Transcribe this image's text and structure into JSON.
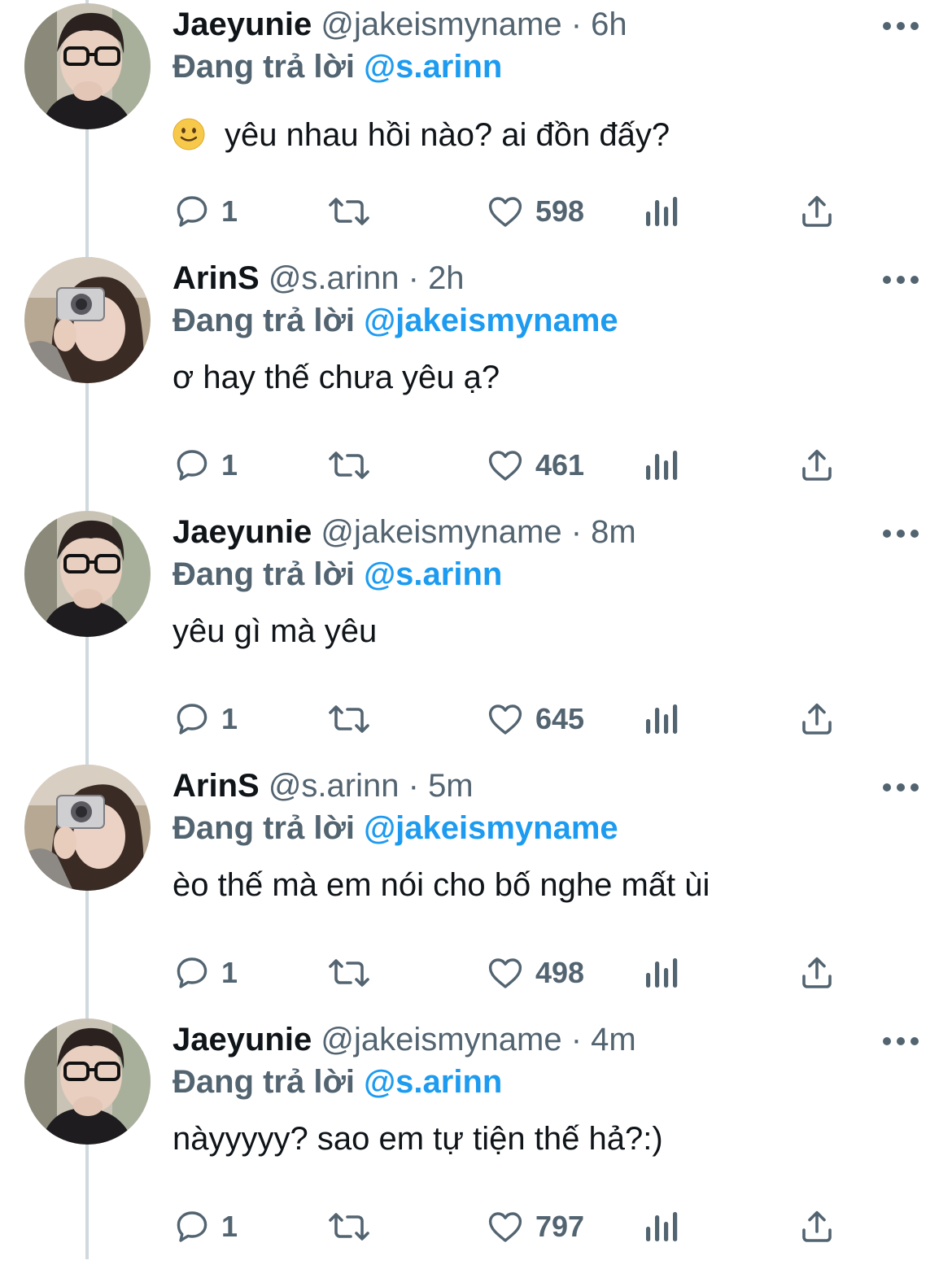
{
  "reply_prefix": "Đang trả lời",
  "tweets": [
    {
      "display_name": "Jaeyunie",
      "handle": "@jakeismyname",
      "separator": "·",
      "time": "6h",
      "replying_to": "@s.arinn",
      "emoji": "slightly-smiling-face",
      "text": "yêu nhau hồi nào? ai đồn đấy?",
      "replies": "1",
      "likes": "598",
      "avatar": "jaeyunie-avatar"
    },
    {
      "display_name": "ArinS",
      "handle": "@s.arinn",
      "separator": "·",
      "time": "2h",
      "replying_to": "@jakeismyname",
      "text": "ơ hay thế chưa yêu ạ?",
      "replies": "1",
      "likes": "461",
      "avatar": "arins-avatar"
    },
    {
      "display_name": "Jaeyunie",
      "handle": "@jakeismyname",
      "separator": "·",
      "time": "8m",
      "replying_to": "@s.arinn",
      "text": "yêu gì mà yêu",
      "replies": "1",
      "likes": "645",
      "avatar": "jaeyunie-avatar"
    },
    {
      "display_name": "ArinS",
      "handle": "@s.arinn",
      "separator": "·",
      "time": "5m",
      "replying_to": "@jakeismyname",
      "text": "èo thế mà em nói cho bố nghe mất ùi",
      "replies": "1",
      "likes": "498",
      "avatar": "arins-avatar"
    },
    {
      "display_name": "Jaeyunie",
      "handle": "@jakeismyname",
      "separator": "·",
      "time": "4m",
      "replying_to": "@s.arinn",
      "text": "nàyyyyy? sao em tự tiện thế hả?:)",
      "replies": "1",
      "likes": "797",
      "avatar": "jaeyunie-avatar"
    }
  ],
  "colors": {
    "text": "#0f1419",
    "secondary": "#536471",
    "accent": "#1d9bf0",
    "thread_line": "#cfd9de"
  },
  "icons": [
    "reply-icon",
    "retweet-icon",
    "like-icon",
    "views-icon",
    "share-icon",
    "more-icon"
  ]
}
